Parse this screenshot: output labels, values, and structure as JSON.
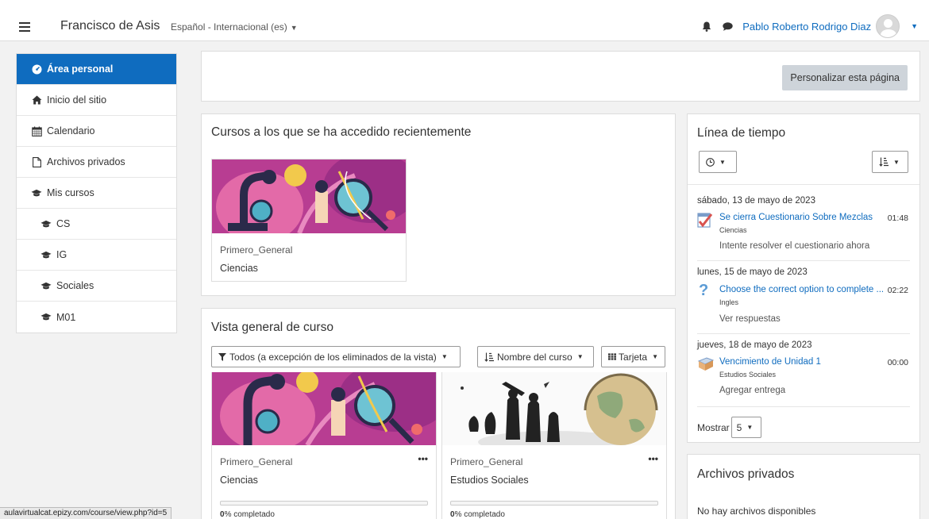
{
  "header": {
    "site_name": "Francisco de Asis",
    "language": "Español - Internacional (es)",
    "user_name": "Pablo Roberto Rodrigo Diaz"
  },
  "drawer": {
    "items": [
      {
        "label": "Área personal",
        "icon": "dashboard-icon"
      },
      {
        "label": "Inicio del sitio",
        "icon": "home-icon"
      },
      {
        "label": "Calendario",
        "icon": "calendar-icon"
      },
      {
        "label": "Archivos privados",
        "icon": "file-icon"
      },
      {
        "label": "Mis cursos",
        "icon": "graduation-cap-icon"
      },
      {
        "label": "CS",
        "icon": "graduation-cap-icon"
      },
      {
        "label": "IG",
        "icon": "graduation-cap-icon"
      },
      {
        "label": "Sociales",
        "icon": "graduation-cap-icon"
      },
      {
        "label": "M01",
        "icon": "graduation-cap-icon"
      }
    ]
  },
  "customize_button": "Personalizar esta página",
  "recent": {
    "title": "Cursos a los que se ha accedido recientemente",
    "course": {
      "category": "Primero_General",
      "name": "Ciencias"
    }
  },
  "overview": {
    "title": "Vista general de curso",
    "filter_label": "Todos (a excepción de los eliminados de la vista)",
    "sort_label": "Nombre del curso",
    "view_label": "Tarjeta",
    "courses": [
      {
        "category": "Primero_General",
        "name": "Ciencias",
        "progress_pct": "0",
        "progress_suffix": "% completado"
      },
      {
        "category": "Primero_General",
        "name": "Estudios Sociales",
        "progress_pct": "0",
        "progress_suffix": "% completado"
      }
    ]
  },
  "timeline": {
    "title": "Línea de tiempo",
    "groups": [
      {
        "date": "sábado, 13 de mayo de 2023",
        "link": "Se cierra Cuestionario Sobre Mezclas",
        "course": "Ciencias",
        "time": "01:48",
        "action": "Intente resolver el cuestionario ahora",
        "icon": "quiz-icon"
      },
      {
        "date": "lunes, 15 de mayo de 2023",
        "link": "Choose the correct option to complete ...",
        "course": "Ingles",
        "time": "02:22",
        "action": "Ver respuestas",
        "icon": "question-icon"
      },
      {
        "date": "jueves, 18 de mayo de 2023",
        "link": "Vencimiento de Unidad 1",
        "course": "Estudios Sociales",
        "time": "00:00",
        "action": "Agregar entrega",
        "icon": "assignment-icon"
      }
    ],
    "show_label": "Mostrar",
    "show_value": "5"
  },
  "private_files": {
    "title": "Archivos privados",
    "empty": "No hay archivos disponibles"
  },
  "status_url": "aulavirtualcat.epizy.com/course/view.php?id=5",
  "colors": {
    "accent": "#0f6cbf",
    "button_gray": "#ced4da"
  }
}
